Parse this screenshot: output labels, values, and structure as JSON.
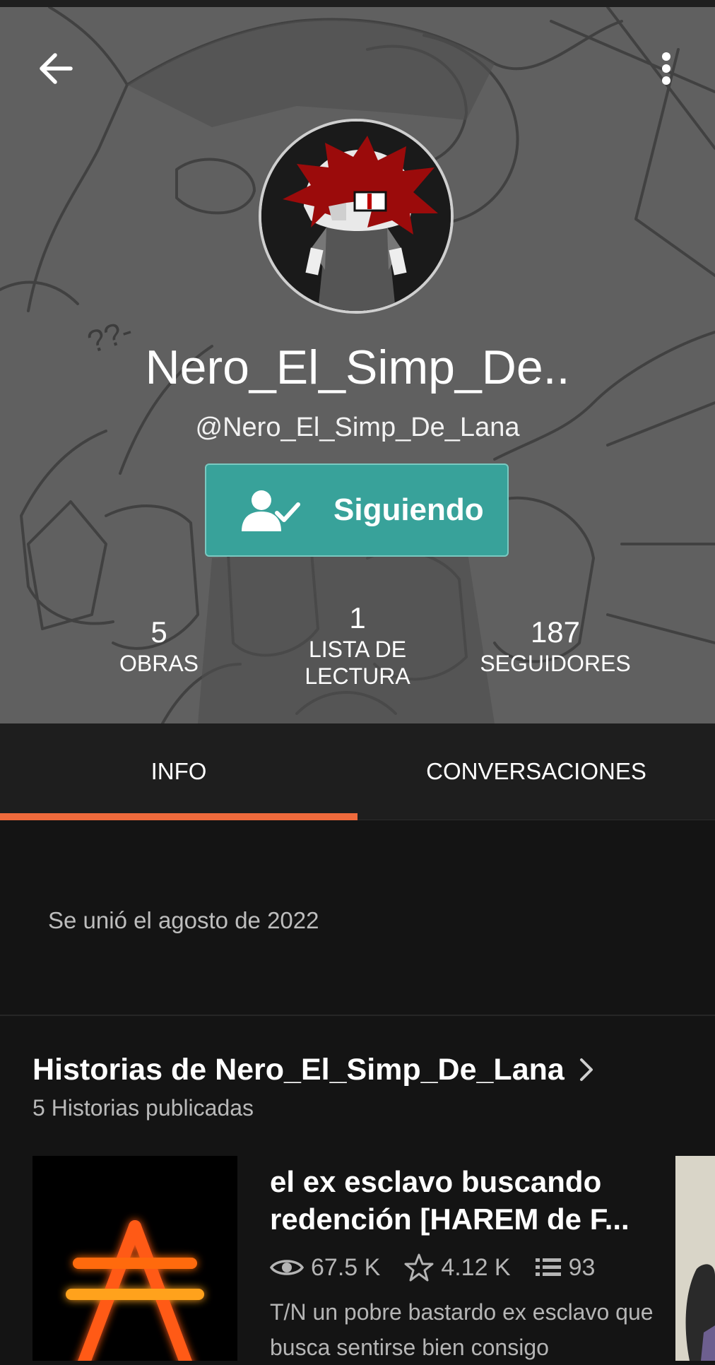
{
  "header": {
    "display_name": "Nero_El_Simp_De..",
    "username": "@Nero_El_Simp_De_Lana",
    "follow_button_label": "Siguiendo",
    "stats": {
      "works": {
        "value": "5",
        "label": "OBRAS"
      },
      "reading_lists": {
        "value": "1",
        "label": "LISTA DE\nLECTURA"
      },
      "followers": {
        "value": "187",
        "label": "SEGUIDORES"
      }
    },
    "background_doodle_text": "??-"
  },
  "tabs": [
    {
      "label": "INFO",
      "active": true
    },
    {
      "label": "CONVERSACIONES",
      "active": false
    }
  ],
  "info": {
    "joined": "Se unió el agosto de 2022"
  },
  "stories": {
    "title": "Historias de Nero_El_Simp_De_Lana",
    "subtitle": "5 Historias publicadas",
    "items": [
      {
        "title": "el ex esclavo buscando redención [HAREM de F...",
        "reads": "67.5 K",
        "votes": "4.12 K",
        "parts": "93",
        "description": "T/N un pobre bastardo ex esclavo que busca sentirse bien consigo"
      }
    ]
  },
  "colors": {
    "accent_orange": "#ee6a3c",
    "follow_teal": "#38a29a",
    "background": "#141414",
    "tabs_background": "#1e1e1e"
  },
  "icons": {
    "back": "arrow-left-icon",
    "more": "more-vertical-icon",
    "follow": "user-check-icon",
    "chevron": "chevron-right-icon",
    "reads": "eye-icon",
    "votes": "star-icon",
    "parts": "list-icon"
  }
}
